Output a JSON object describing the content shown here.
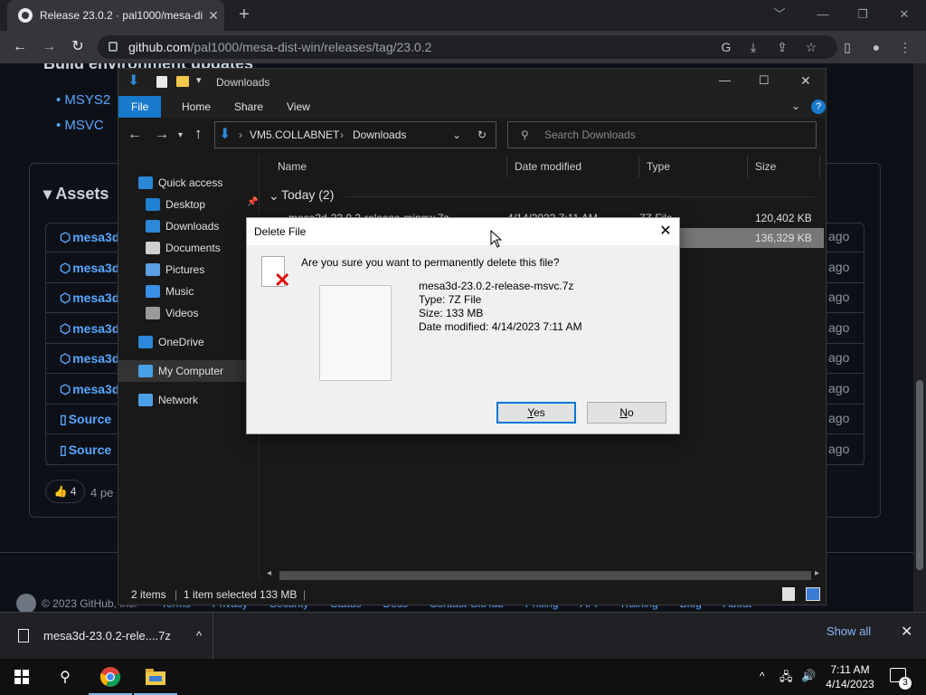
{
  "browser": {
    "tab_title": "Release 23.0.2 · pal1000/mesa-dis",
    "url_host": "github.com",
    "url_path": "/pal1000/mesa-dist-win/releases/tag/23.0.2",
    "new_tab": "+",
    "win_min": "﹀",
    "win_minimize": "—",
    "win_restore": "❐",
    "win_close": "✕"
  },
  "github": {
    "section_heading": "Build environment updates",
    "bullet_1": "MSYS2",
    "bullet_2": "MSVC",
    "assets_heading": "▾ Assets",
    "assets": [
      {
        "name": "mesa3d",
        "age": "ago"
      },
      {
        "name": "mesa3d",
        "age": "ago"
      },
      {
        "name": "mesa3d",
        "age": "ago"
      },
      {
        "name": "mesa3d",
        "age": "ago"
      },
      {
        "name": "mesa3d",
        "age": "ago"
      },
      {
        "name": "mesa3d",
        "age": "ago"
      },
      {
        "name": "Source",
        "age": "ago"
      },
      {
        "name": "Source",
        "age": "ago"
      }
    ],
    "reaction": "👍 4",
    "reaction_people": "4 pe",
    "footer_copyright": "© 2023 GitHub, Inc.",
    "footer_links": [
      "Terms",
      "Privacy",
      "Security",
      "Status",
      "Docs",
      "Contact GitHub",
      "Pricing",
      "API",
      "Training",
      "Blog",
      "About"
    ]
  },
  "explorer": {
    "title": "Downloads",
    "ribbon_tabs": [
      "File",
      "Home",
      "Share",
      "View"
    ],
    "help": "?",
    "address_root": "VM5.COLLABNET",
    "address_folder": "Downloads",
    "search_placeholder": "Search Downloads",
    "nav": [
      {
        "label": "Quick access",
        "icon": "star-icon",
        "color": "#2b88d8"
      },
      {
        "label": "Desktop",
        "icon": "desktop-icon",
        "color": "#1f7fd1"
      },
      {
        "label": "Downloads",
        "icon": "download-icon",
        "color": "#2b88d8"
      },
      {
        "label": "Documents",
        "icon": "documents-icon",
        "color": "#d0d0d0"
      },
      {
        "label": "Pictures",
        "icon": "pictures-icon",
        "color": "#5aa0e0"
      },
      {
        "label": "Music",
        "icon": "music-icon",
        "color": "#3a8ee6"
      },
      {
        "label": "Videos",
        "icon": "videos-icon",
        "color": "#9a9a9a"
      },
      {
        "label": "OneDrive",
        "icon": "cloud-icon",
        "color": "#2b88d8"
      },
      {
        "label": "My Computer",
        "icon": "computer-icon",
        "color": "#4aa0e6"
      },
      {
        "label": "Network",
        "icon": "network-icon",
        "color": "#4aa0e6"
      }
    ],
    "columns": [
      "Name",
      "Date modified",
      "Type",
      "Size"
    ],
    "group_label": "Today (2)",
    "files": [
      {
        "name": "mesa3d-23.0.2-release-mingw.7z",
        "date": "4/14/2023 7:11 AM",
        "type": "7Z File",
        "size": "120,402 KB"
      },
      {
        "name": "mesa3d-23.0.2-release-msvc.7z",
        "date": "4/14/2023 7:11 AM",
        "type": "7Z File",
        "size": "136,329 KB"
      }
    ],
    "status_items": "2 items",
    "status_selected": "1 item selected  133 MB"
  },
  "dialog": {
    "title": "Delete File",
    "question": "Are you sure you want to permanently delete this file?",
    "file_name": "mesa3d-23.0.2-release-msvc.7z",
    "file_type": "Type: 7Z File",
    "file_size": "Size: 133 MB",
    "file_date": "Date modified: 4/14/2023 7:11 AM",
    "yes_u": "Y",
    "yes_rest": "es",
    "no_u": "N",
    "no_rest": "o"
  },
  "shelf": {
    "download_name": "mesa3d-23.0.2-rele....7z",
    "show_all": "Show all",
    "chevron": "^",
    "close": "✕"
  },
  "taskbar": {
    "time": "7:11 AM",
    "date": "4/14/2023",
    "notifications": "3"
  }
}
